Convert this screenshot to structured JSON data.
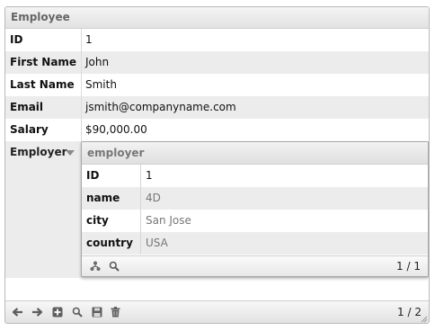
{
  "form": {
    "title": "Employee",
    "fields": [
      {
        "label": "ID",
        "value": "1"
      },
      {
        "label": "First Name",
        "value": "John"
      },
      {
        "label": "Last Name",
        "value": "Smith"
      },
      {
        "label": "Email",
        "value": "jsmith@companyname.com"
      },
      {
        "label": "Salary",
        "value": "$90,000.00"
      }
    ],
    "employer_label": "Employer",
    "pager": "1 / 2",
    "toolbar_icons": [
      "arrow-left-icon",
      "arrow-right-icon",
      "add-record-icon",
      "search-icon",
      "save-icon",
      "trash-icon"
    ]
  },
  "employer": {
    "title": "employer",
    "fields": [
      {
        "label": "ID",
        "value": "1"
      },
      {
        "label": "name",
        "value": "4D"
      },
      {
        "label": "city",
        "value": "San Jose"
      },
      {
        "label": "country",
        "value": "USA"
      }
    ],
    "pager": "1 / 1",
    "toolbar_icons": [
      "relation-tree-icon",
      "search-icon"
    ]
  }
}
